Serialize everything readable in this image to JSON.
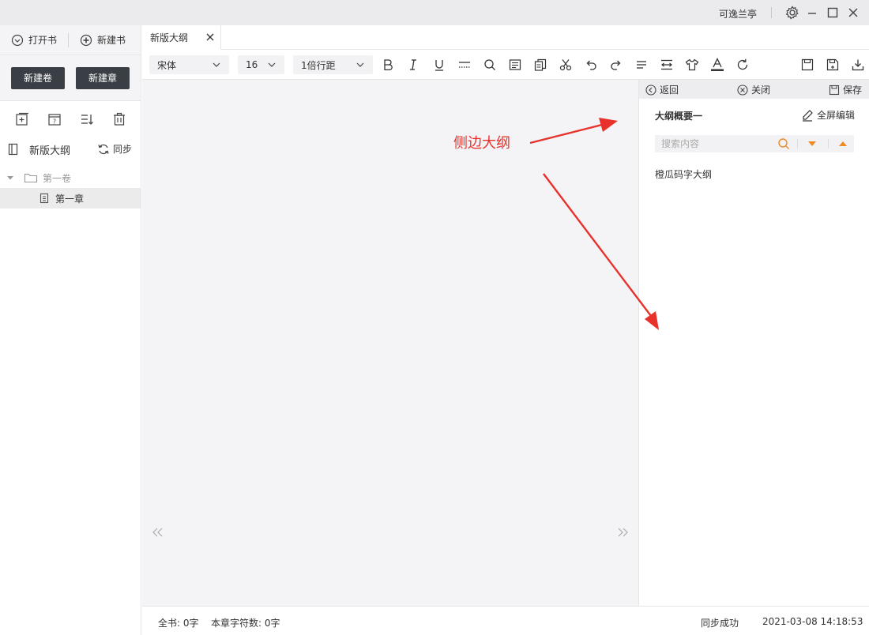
{
  "titlebar": {
    "user_name": "可逸兰亭",
    "icons": [
      "gear-icon",
      "minimize-icon",
      "maximize-icon",
      "close-icon"
    ]
  },
  "sidebar": {
    "open_book": "打开书",
    "new_book": "新建书",
    "new_volume": "新建卷",
    "new_chapter": "新建章",
    "tool_icons": [
      "add-chapter-icon",
      "insert-chapter-icon",
      "sort-icon",
      "trash-icon"
    ],
    "book_name": "新版大纲",
    "sync": "同步",
    "volume": "第一卷",
    "chapter": "第一章"
  },
  "tabs": [
    {
      "label": "新版大纲",
      "active": true
    }
  ],
  "toolbar": {
    "font": "宋体",
    "size": "16",
    "line_spacing": "1倍行距",
    "tools": [
      "bold-icon",
      "italic-icon",
      "underline-icon",
      "divider-icon",
      "search-icon",
      "format-icon",
      "copy-icon",
      "cut-icon",
      "undo-icon",
      "redo-icon",
      "align-icon",
      "indent-icon",
      "theme-icon",
      "font-color-icon",
      "refresh-icon",
      "save-icon",
      "save-as-icon",
      "download-icon"
    ],
    "font_color": "#333333"
  },
  "outline_panel": {
    "back": "返回",
    "close": "关闭",
    "save": "保存",
    "title": "大纲概要一",
    "fullscreen_edit": "全屏编辑",
    "search_placeholder": "搜索内容",
    "items": [
      "橙瓜码字大纲"
    ],
    "accent_color": "#f08a24"
  },
  "annotation": {
    "label": "侧边大纲",
    "color": "#e8312a"
  },
  "statusbar": {
    "book_count": "全书: 0字",
    "chapter_count": "本章字符数: 0字",
    "sync_status": "同步成功",
    "timestamp": "2021-03-08 14:18:53"
  }
}
